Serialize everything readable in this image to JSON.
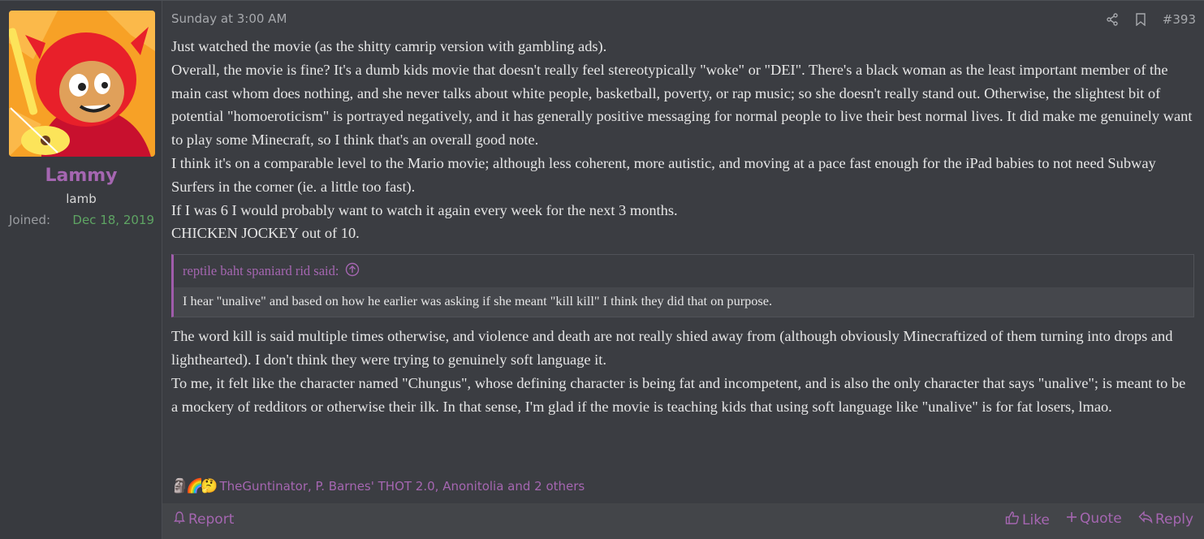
{
  "user": {
    "name": "Lammy",
    "title": "lamb",
    "joined_label": "Joined:",
    "joined_value": "Dec 18, 2019"
  },
  "post": {
    "date": "Sunday at 3:00 AM",
    "number": "#393",
    "paragraphs": [
      "Just watched the movie (as the shitty camrip version with gambling ads).",
      "Overall, the movie is fine? It's a dumb kids movie that doesn't really feel stereotypically \"woke\" or \"DEI\". There's a black woman as the least important member of the main cast whom does nothing, and she never talks about white people, basketball, poverty, or rap music; so she doesn't really stand out. Otherwise, the slightest bit of potential \"homoeroticism\" is portrayed negatively, and it has generally positive messaging for normal people to live their best normal lives. It did make me genuinely want to play some Minecraft, so I think that's an overall good note.",
      "I think it's on a comparable level to the Mario movie; although less coherent, more autistic, and moving at a pace fast enough for the iPad babies to not need Subway Surfers in the corner (ie. a little too fast).",
      "If I was 6 I would probably want to watch it again every week for the next 3 months.",
      "CHICKEN JOCKEY out of 10."
    ],
    "quote": {
      "author_line": "reptile baht spaniard rid said:",
      "text": "I hear \"unalive\" and based on how he earlier was asking if she meant \"kill kill\" I think they did that on purpose."
    },
    "paragraphs_after": [
      "The word kill is said multiple times otherwise, and violence and death are not really shied away from (although obviously Minecraftized of them turning into drops and lighthearted). I don't think they were trying to genuinely soft language it.",
      "To me, it felt like the character named \"Chungus\", whose defining character is being fat and incompetent, and is also the only character that says \"unalive\"; is meant to be a mockery of redditors or otherwise their ilk. In that sense, I'm glad if the movie is teaching kids that using soft language like \"unalive\" is for fat losers, lmao."
    ]
  },
  "reactions": {
    "icons": [
      "🗿",
      "🌈",
      "🤔"
    ],
    "text": "TheGuntinator, P. Barnes' THOT 2.0, Anonitolia and 2 others"
  },
  "footer": {
    "report": "Report",
    "like": "Like",
    "quote": "Quote",
    "reply": "Reply"
  },
  "colors": {
    "accent": "#a566b1",
    "joined_date": "#5ea463",
    "background": "#3b3d42",
    "footer_bg": "#434549"
  },
  "icons": [
    "share-icon",
    "bookmark-icon",
    "arrow-up-circle-icon",
    "flag-icon",
    "thumbs-up-icon",
    "plus-icon",
    "reply-arrow-icon"
  ]
}
